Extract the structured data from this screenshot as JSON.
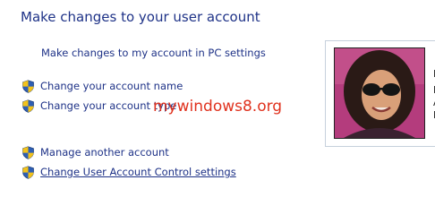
{
  "page": {
    "heading": "Make changes to your user account"
  },
  "links": {
    "pc_settings": "Make changes to my account in PC settings",
    "change_name": "Change your account name",
    "change_type": "Change your account type",
    "manage_another": "Manage another account",
    "uac_settings": "Change User Account Control settings"
  },
  "watermark": "mywindows8.org",
  "account": {
    "picture_icon": "user-photo",
    "details_partial": [
      "D",
      "L",
      "A",
      "P"
    ]
  },
  "colors": {
    "link": "#1e3287",
    "watermark": "#e0321e",
    "panel_border": "#c6d0dc"
  }
}
